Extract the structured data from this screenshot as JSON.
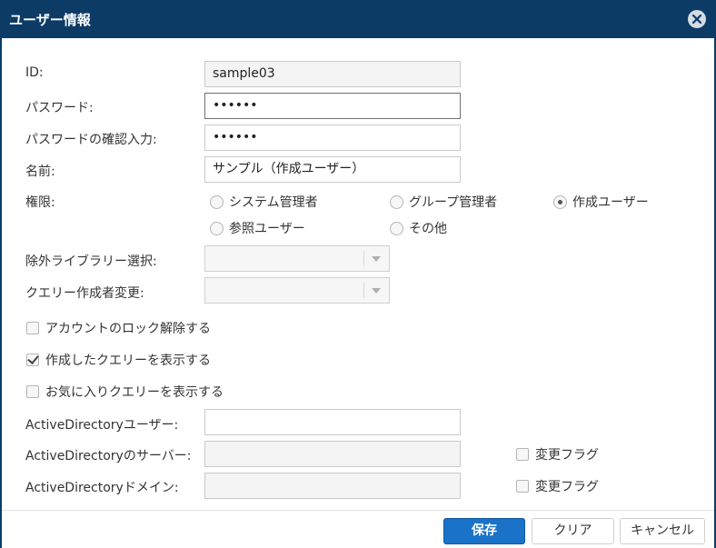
{
  "dialog": {
    "title": "ユーザー情報"
  },
  "form": {
    "id": {
      "label": "ID:",
      "value": "sample03"
    },
    "password": {
      "label": "パスワード:",
      "value": "••••••"
    },
    "password_confirm": {
      "label": "パスワードの確認入力:",
      "value": "••••••"
    },
    "name": {
      "label": "名前:",
      "value": "サンプル（作成ユーザー）"
    },
    "permission": {
      "label": "権限:",
      "options": [
        "システム管理者",
        "グループ管理者",
        "作成ユーザー",
        "参照ユーザー",
        "その他"
      ],
      "selected": "作成ユーザー"
    },
    "exclude_library": {
      "label": "除外ライブラリー選択:",
      "value": ""
    },
    "query_creator_change": {
      "label": "クエリー作成者変更:",
      "value": ""
    },
    "unlock_account": {
      "label": "アカウントのロック解除する",
      "checked": false
    },
    "show_created_queries": {
      "label": "作成したクエリーを表示する",
      "checked": true
    },
    "show_favorite_queries": {
      "label": "お気に入りクエリーを表示する",
      "checked": false
    },
    "ad_user": {
      "label": "ActiveDirectoryユーザー:",
      "value": ""
    },
    "ad_server": {
      "label": "ActiveDirectoryのサーバー:",
      "value": "",
      "change_flag_label": "変更フラグ",
      "change_flag_checked": false
    },
    "ad_domain": {
      "label": "ActiveDirectoryドメイン:",
      "value": "",
      "change_flag_label": "変更フラグ",
      "change_flag_checked": false
    }
  },
  "buttons": {
    "save": "保存",
    "clear": "クリア",
    "cancel": "キャンセル"
  }
}
